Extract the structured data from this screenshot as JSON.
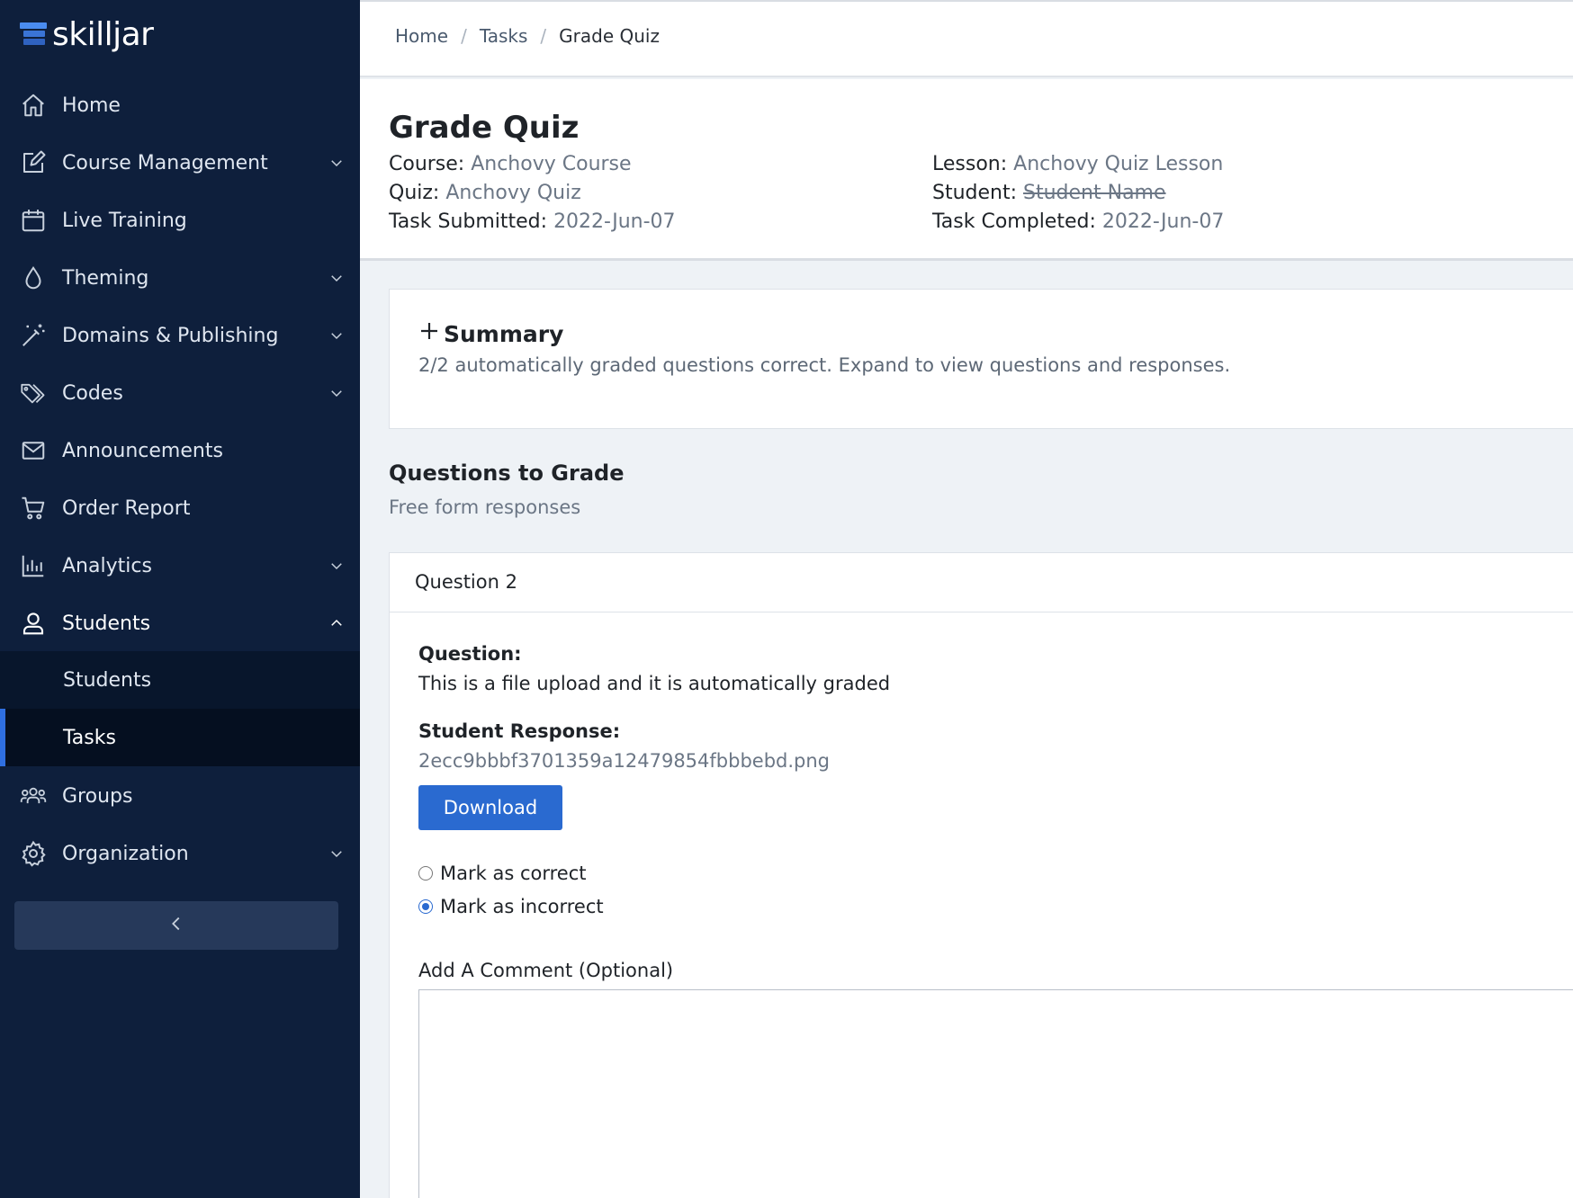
{
  "brand": {
    "name": "skilljar",
    "accent": "#4a8cf0"
  },
  "sidebar": {
    "items": [
      {
        "label": "Home",
        "icon": "home-icon",
        "has_chevron": false
      },
      {
        "label": "Course Management",
        "icon": "edit-icon",
        "has_chevron": true
      },
      {
        "label": "Live Training",
        "icon": "calendar-icon",
        "has_chevron": false
      },
      {
        "label": "Theming",
        "icon": "droplet-icon",
        "has_chevron": true
      },
      {
        "label": "Domains & Publishing",
        "icon": "magic-wand-icon",
        "has_chevron": true
      },
      {
        "label": "Codes",
        "icon": "tag-icon",
        "has_chevron": true
      },
      {
        "label": "Announcements",
        "icon": "mail-icon",
        "has_chevron": false
      },
      {
        "label": "Order Report",
        "icon": "cart-icon",
        "has_chevron": false
      },
      {
        "label": "Analytics",
        "icon": "bar-chart-icon",
        "has_chevron": true
      },
      {
        "label": "Students",
        "icon": "user-icon",
        "has_chevron": true,
        "expanded": true
      },
      {
        "label": "Groups",
        "icon": "users-icon",
        "has_chevron": false
      },
      {
        "label": "Organization",
        "icon": "gear-icon",
        "has_chevron": true
      }
    ],
    "students_submenu": [
      {
        "label": "Students",
        "active": false
      },
      {
        "label": "Tasks",
        "active": true
      }
    ],
    "collapse_icon": "chevron-left-icon"
  },
  "breadcrumb": {
    "home": "Home",
    "tasks": "Tasks",
    "current": "Grade Quiz",
    "separator": "/"
  },
  "header": {
    "title": "Grade Quiz",
    "course_label": "Course:",
    "course_value": "Anchovy Course",
    "quiz_label": "Quiz:",
    "quiz_value": "Anchovy Quiz",
    "submitted_label": "Task Submitted:",
    "submitted_value": "2022-Jun-07",
    "lesson_label": "Lesson:",
    "lesson_value": "Anchovy Quiz Lesson",
    "student_label": "Student:",
    "student_value": "Student Name",
    "completed_label": "Task Completed:",
    "completed_value": "2022-Jun-07"
  },
  "summary": {
    "title": "Summary",
    "description": "2/2 automatically graded questions correct. Expand to view questions and responses."
  },
  "questions_section": {
    "title": "Questions to Grade",
    "subtitle": "Free form responses"
  },
  "question": {
    "header": "Question 2",
    "question_label": "Question:",
    "question_text": "This is a file upload and it is automatically graded",
    "response_label": "Student Response:",
    "response_file": "2ecc9bbbf3701359a12479854fbbbebd.png",
    "download_label": "Download",
    "mark_correct_label": "Mark as correct",
    "mark_incorrect_label": "Mark as incorrect",
    "selected": "incorrect",
    "comment_label": "Add A Comment (Optional)",
    "comment_value": ""
  }
}
